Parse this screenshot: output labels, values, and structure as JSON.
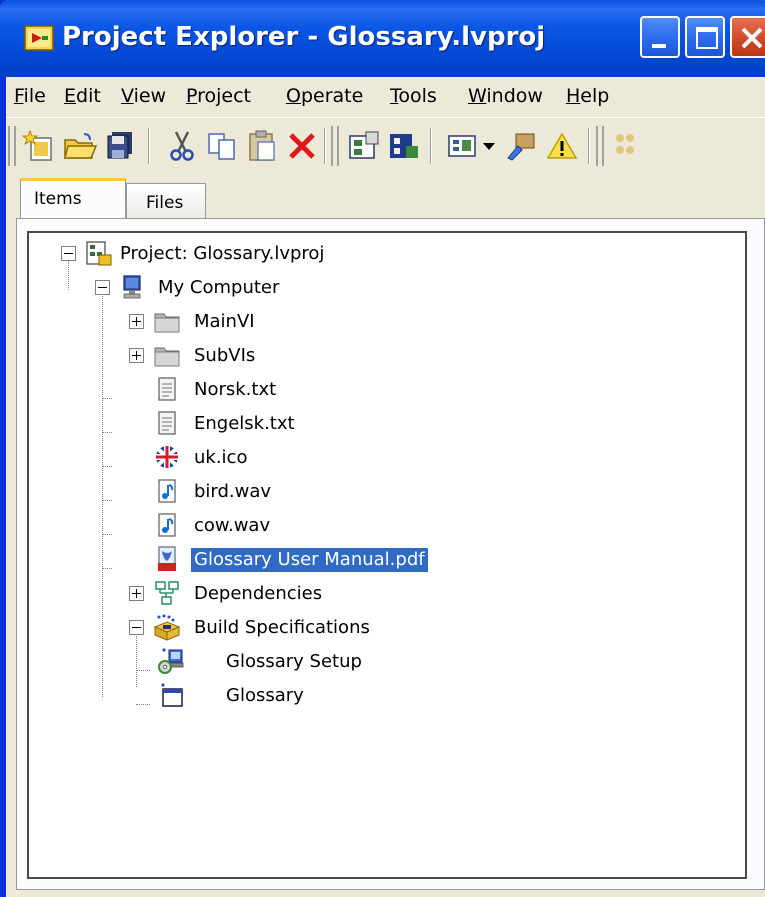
{
  "window": {
    "title": "Project Explorer - Glossary.lvproj",
    "colors": {
      "title_bar": "#0a57e6",
      "selection": "#316ac5",
      "close_button": "#d04b28"
    }
  },
  "menu": [
    {
      "label": "File",
      "mnemonic": "F"
    },
    {
      "label": "Edit",
      "mnemonic": "E"
    },
    {
      "label": "View",
      "mnemonic": "V"
    },
    {
      "label": "Project",
      "mnemonic": "P"
    },
    {
      "label": "Operate",
      "mnemonic": "O"
    },
    {
      "label": "Tools",
      "mnemonic": "T"
    },
    {
      "label": "Window",
      "mnemonic": "W"
    },
    {
      "label": "Help",
      "mnemonic": "H"
    }
  ],
  "toolbar": {
    "icons": [
      "new-icon",
      "open-icon",
      "save-all-icon",
      "cut-icon",
      "copy-icon",
      "paste-icon",
      "delete-icon",
      "project-properties-icon",
      "vi-properties-icon",
      "view-icon",
      "dropdown-arrow-icon",
      "tools-icon",
      "warning-icon",
      "build-icon"
    ]
  },
  "tabs": [
    {
      "label": "Items",
      "active": true
    },
    {
      "label": "Files",
      "active": false
    }
  ],
  "tree": {
    "items": [
      {
        "label": "Project: Glossary.lvproj",
        "icon": "project-icon",
        "expanded": true
      },
      {
        "label": "My Computer",
        "icon": "computer-icon",
        "expanded": true
      },
      {
        "label": "MainVI",
        "icon": "folder-icon",
        "expanded": false
      },
      {
        "label": "SubVIs",
        "icon": "folder-icon",
        "expanded": false
      },
      {
        "label": "Norsk.txt",
        "icon": "text-file-icon"
      },
      {
        "label": "Engelsk.txt",
        "icon": "text-file-icon"
      },
      {
        "label": "uk.ico",
        "icon": "uk-flag-icon"
      },
      {
        "label": "bird.wav",
        "icon": "audio-file-icon"
      },
      {
        "label": "cow.wav",
        "icon": "audio-file-icon"
      },
      {
        "label": "Glossary User Manual.pdf",
        "icon": "pdf-file-icon",
        "selected": true
      },
      {
        "label": "Dependencies",
        "icon": "dependencies-icon",
        "expanded": false
      },
      {
        "label": "Build Specifications",
        "icon": "build-specifications-icon",
        "expanded": true
      },
      {
        "label": "Glossary Setup",
        "icon": "installer-icon"
      },
      {
        "label": "Glossary",
        "icon": "application-icon"
      }
    ]
  }
}
